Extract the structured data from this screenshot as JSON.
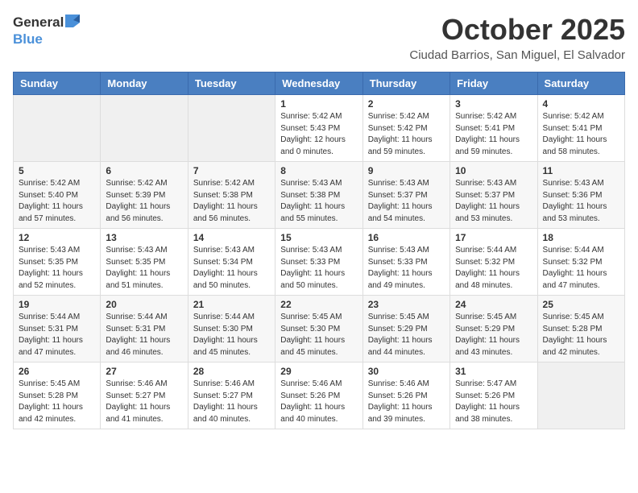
{
  "header": {
    "logo_general": "General",
    "logo_blue": "Blue",
    "title": "October 2025",
    "location": "Ciudad Barrios, San Miguel, El Salvador"
  },
  "columns": [
    "Sunday",
    "Monday",
    "Tuesday",
    "Wednesday",
    "Thursday",
    "Friday",
    "Saturday"
  ],
  "weeks": [
    {
      "days": [
        {
          "num": "",
          "info": ""
        },
        {
          "num": "",
          "info": ""
        },
        {
          "num": "",
          "info": ""
        },
        {
          "num": "1",
          "info": "Sunrise: 5:42 AM\nSunset: 5:43 PM\nDaylight: 12 hours\nand 0 minutes."
        },
        {
          "num": "2",
          "info": "Sunrise: 5:42 AM\nSunset: 5:42 PM\nDaylight: 11 hours\nand 59 minutes."
        },
        {
          "num": "3",
          "info": "Sunrise: 5:42 AM\nSunset: 5:41 PM\nDaylight: 11 hours\nand 59 minutes."
        },
        {
          "num": "4",
          "info": "Sunrise: 5:42 AM\nSunset: 5:41 PM\nDaylight: 11 hours\nand 58 minutes."
        }
      ]
    },
    {
      "days": [
        {
          "num": "5",
          "info": "Sunrise: 5:42 AM\nSunset: 5:40 PM\nDaylight: 11 hours\nand 57 minutes."
        },
        {
          "num": "6",
          "info": "Sunrise: 5:42 AM\nSunset: 5:39 PM\nDaylight: 11 hours\nand 56 minutes."
        },
        {
          "num": "7",
          "info": "Sunrise: 5:42 AM\nSunset: 5:38 PM\nDaylight: 11 hours\nand 56 minutes."
        },
        {
          "num": "8",
          "info": "Sunrise: 5:43 AM\nSunset: 5:38 PM\nDaylight: 11 hours\nand 55 minutes."
        },
        {
          "num": "9",
          "info": "Sunrise: 5:43 AM\nSunset: 5:37 PM\nDaylight: 11 hours\nand 54 minutes."
        },
        {
          "num": "10",
          "info": "Sunrise: 5:43 AM\nSunset: 5:37 PM\nDaylight: 11 hours\nand 53 minutes."
        },
        {
          "num": "11",
          "info": "Sunrise: 5:43 AM\nSunset: 5:36 PM\nDaylight: 11 hours\nand 53 minutes."
        }
      ]
    },
    {
      "days": [
        {
          "num": "12",
          "info": "Sunrise: 5:43 AM\nSunset: 5:35 PM\nDaylight: 11 hours\nand 52 minutes."
        },
        {
          "num": "13",
          "info": "Sunrise: 5:43 AM\nSunset: 5:35 PM\nDaylight: 11 hours\nand 51 minutes."
        },
        {
          "num": "14",
          "info": "Sunrise: 5:43 AM\nSunset: 5:34 PM\nDaylight: 11 hours\nand 50 minutes."
        },
        {
          "num": "15",
          "info": "Sunrise: 5:43 AM\nSunset: 5:33 PM\nDaylight: 11 hours\nand 50 minutes."
        },
        {
          "num": "16",
          "info": "Sunrise: 5:43 AM\nSunset: 5:33 PM\nDaylight: 11 hours\nand 49 minutes."
        },
        {
          "num": "17",
          "info": "Sunrise: 5:44 AM\nSunset: 5:32 PM\nDaylight: 11 hours\nand 48 minutes."
        },
        {
          "num": "18",
          "info": "Sunrise: 5:44 AM\nSunset: 5:32 PM\nDaylight: 11 hours\nand 47 minutes."
        }
      ]
    },
    {
      "days": [
        {
          "num": "19",
          "info": "Sunrise: 5:44 AM\nSunset: 5:31 PM\nDaylight: 11 hours\nand 47 minutes."
        },
        {
          "num": "20",
          "info": "Sunrise: 5:44 AM\nSunset: 5:31 PM\nDaylight: 11 hours\nand 46 minutes."
        },
        {
          "num": "21",
          "info": "Sunrise: 5:44 AM\nSunset: 5:30 PM\nDaylight: 11 hours\nand 45 minutes."
        },
        {
          "num": "22",
          "info": "Sunrise: 5:45 AM\nSunset: 5:30 PM\nDaylight: 11 hours\nand 45 minutes."
        },
        {
          "num": "23",
          "info": "Sunrise: 5:45 AM\nSunset: 5:29 PM\nDaylight: 11 hours\nand 44 minutes."
        },
        {
          "num": "24",
          "info": "Sunrise: 5:45 AM\nSunset: 5:29 PM\nDaylight: 11 hours\nand 43 minutes."
        },
        {
          "num": "25",
          "info": "Sunrise: 5:45 AM\nSunset: 5:28 PM\nDaylight: 11 hours\nand 42 minutes."
        }
      ]
    },
    {
      "days": [
        {
          "num": "26",
          "info": "Sunrise: 5:45 AM\nSunset: 5:28 PM\nDaylight: 11 hours\nand 42 minutes."
        },
        {
          "num": "27",
          "info": "Sunrise: 5:46 AM\nSunset: 5:27 PM\nDaylight: 11 hours\nand 41 minutes."
        },
        {
          "num": "28",
          "info": "Sunrise: 5:46 AM\nSunset: 5:27 PM\nDaylight: 11 hours\nand 40 minutes."
        },
        {
          "num": "29",
          "info": "Sunrise: 5:46 AM\nSunset: 5:26 PM\nDaylight: 11 hours\nand 40 minutes."
        },
        {
          "num": "30",
          "info": "Sunrise: 5:46 AM\nSunset: 5:26 PM\nDaylight: 11 hours\nand 39 minutes."
        },
        {
          "num": "31",
          "info": "Sunrise: 5:47 AM\nSunset: 5:26 PM\nDaylight: 11 hours\nand 38 minutes."
        },
        {
          "num": "",
          "info": ""
        }
      ]
    }
  ]
}
